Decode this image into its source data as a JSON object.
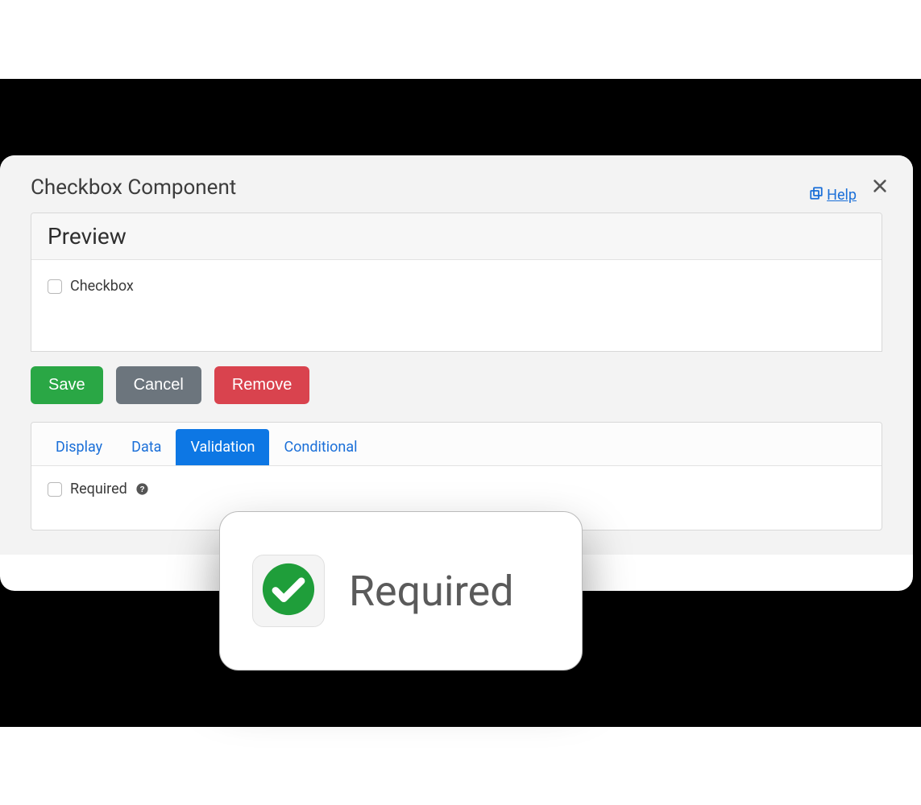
{
  "modal": {
    "title": "Checkbox Component",
    "help_label": "Help"
  },
  "preview": {
    "heading": "Preview",
    "checkbox_label": "Checkbox"
  },
  "buttons": {
    "save": "Save",
    "cancel": "Cancel",
    "remove": "Remove"
  },
  "tabs": {
    "display": "Display",
    "data": "Data",
    "validation": "Validation",
    "conditional": "Conditional",
    "active": "validation"
  },
  "validation": {
    "required_label": "Required"
  },
  "callout": {
    "label": "Required"
  }
}
